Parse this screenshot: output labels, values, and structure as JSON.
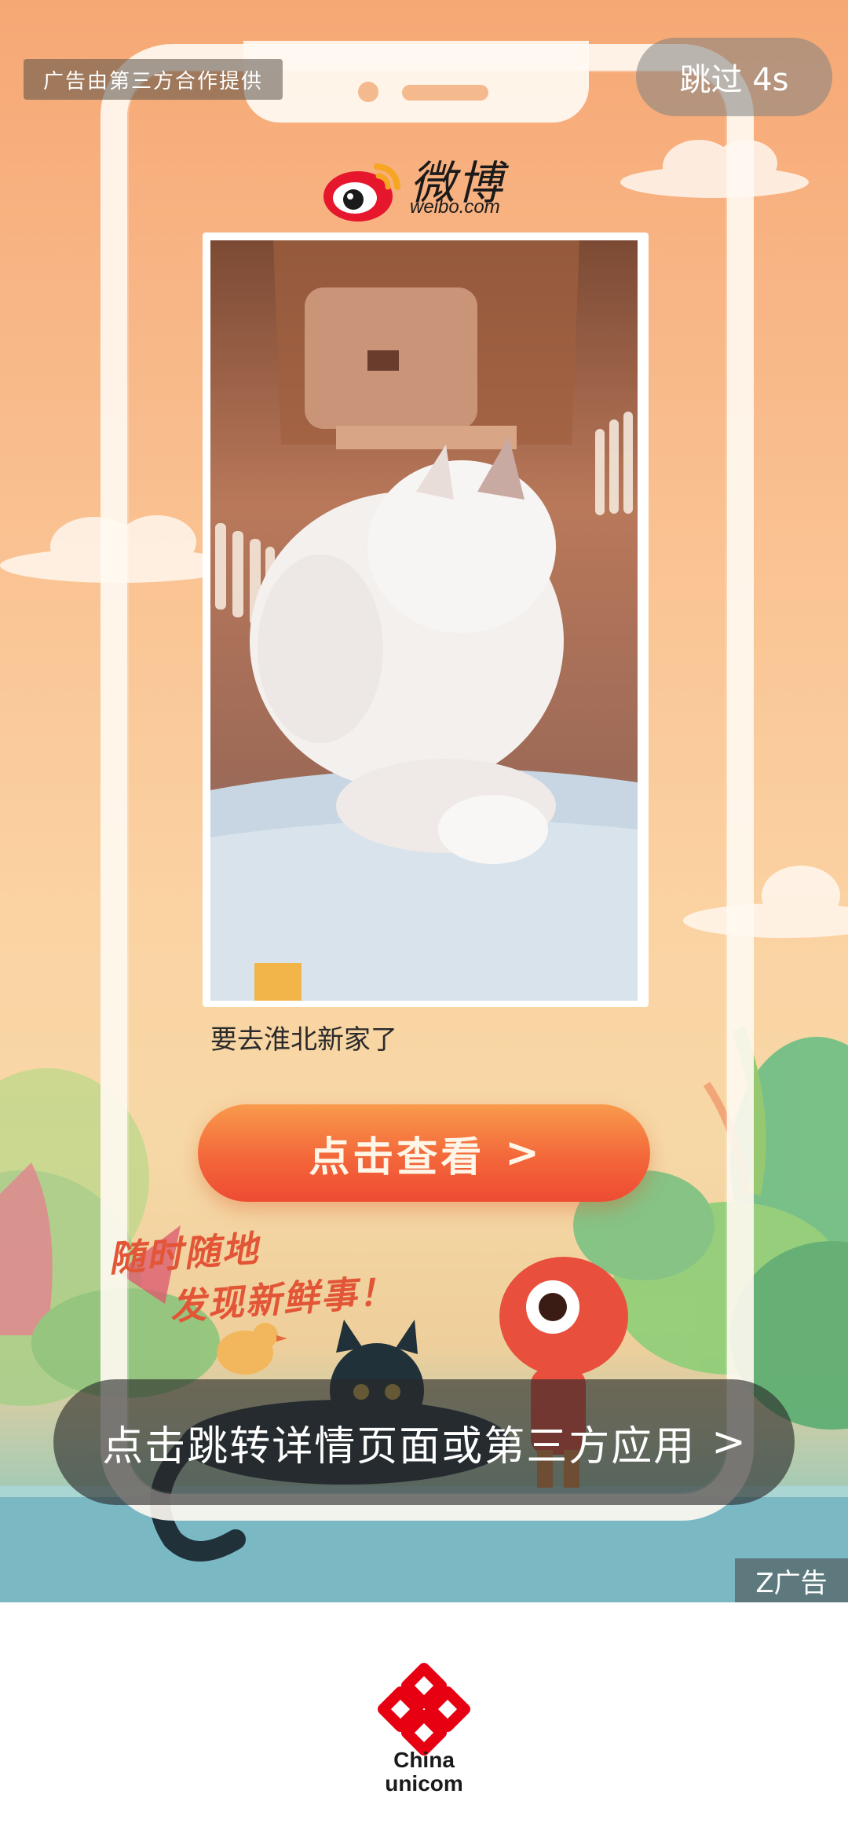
{
  "ad": {
    "sponsor_notice": "广告由第三方合作提供",
    "skip_label": "跳过 4s",
    "brand": {
      "name": "微博",
      "domain": "weibo.com"
    },
    "post": {
      "image": "white-persian-cat-in-pet-carrier",
      "caption": "要去淮北新家了"
    },
    "cta_label": "点击查看",
    "cta_arrow": ">",
    "slogan_line1": "随时随地",
    "slogan_line2": "发现新鲜事！",
    "jump_label": "点击跳转详情页面或第三方应用",
    "jump_arrow": ">",
    "ad_tag": "Z广告"
  },
  "footer": {
    "carrier_line1": "China",
    "carrier_line2": "unicom"
  },
  "colors": {
    "cta": "#f3673a",
    "brand_red": "#e6162d",
    "unicom_red": "#e60012"
  }
}
